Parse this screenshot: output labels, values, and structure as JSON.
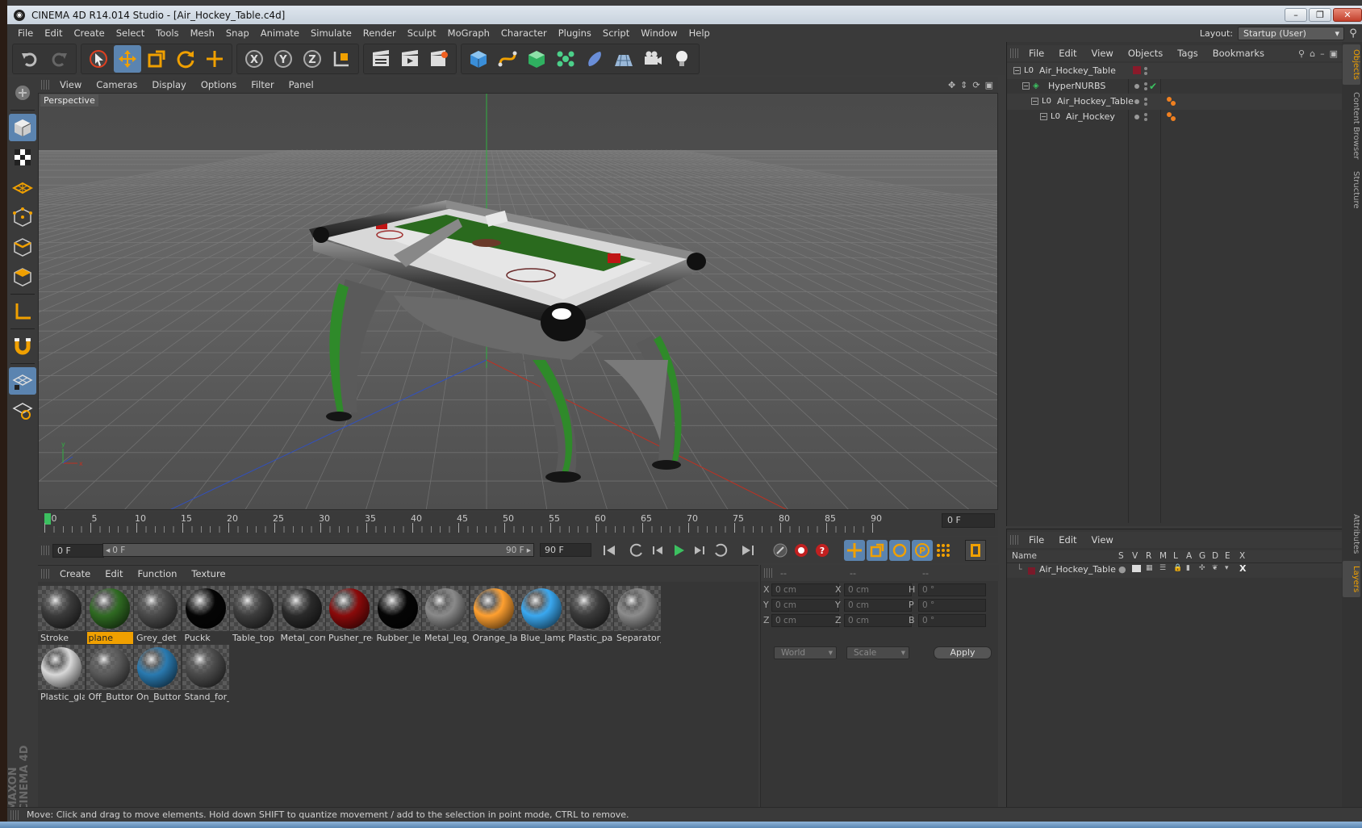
{
  "window": {
    "title": "CINEMA 4D R14.014 Studio - [Air_Hockey_Table.c4d]",
    "controls": [
      "–",
      "❐",
      "✕"
    ]
  },
  "menu": [
    "File",
    "Edit",
    "Create",
    "Select",
    "Tools",
    "Mesh",
    "Snap",
    "Animate",
    "Simulate",
    "Render",
    "Sculpt",
    "MoGraph",
    "Character",
    "Plugins",
    "Script",
    "Window",
    "Help"
  ],
  "layout": {
    "label": "Layout:",
    "value": "Startup (User)"
  },
  "viewport": {
    "menu": [
      "View",
      "Cameras",
      "Display",
      "Options",
      "Filter",
      "Panel"
    ],
    "camera_label": "Perspective"
  },
  "timeline": {
    "ticks": [
      "0",
      "5",
      "10",
      "15",
      "20",
      "25",
      "30",
      "35",
      "40",
      "45",
      "50",
      "55",
      "60",
      "65",
      "70",
      "75",
      "80",
      "85",
      "90"
    ],
    "current_frame_field": "0 F"
  },
  "transport": {
    "start_field": "0 F",
    "range_start": "0 F",
    "range_end": "90 F",
    "end_field": "90 F"
  },
  "materials": {
    "menu": [
      "Create",
      "Edit",
      "Function",
      "Texture"
    ],
    "items": [
      {
        "name": "Stroke",
        "color": "#3a3a3a",
        "selected": false
      },
      {
        "name": "plane",
        "color": "#2f6a22",
        "selected": true
      },
      {
        "name": "Grey_det",
        "color": "#4a4a4a",
        "selected": false
      },
      {
        "name": "Puckk",
        "color": "#050505",
        "selected": false
      },
      {
        "name": "Table_top",
        "color": "#3c3c3c",
        "selected": false
      },
      {
        "name": "Metal_corn",
        "color": "#2a2a2a",
        "selected": false
      },
      {
        "name": "Pusher_red",
        "color": "#8a0a0a",
        "selected": false
      },
      {
        "name": "Rubber_leg",
        "color": "#050505",
        "selected": false
      },
      {
        "name": "Metal_leg_",
        "color": "#8a8a8a",
        "selected": false
      },
      {
        "name": "Orange_lar",
        "color": "#ffa030",
        "selected": false
      },
      {
        "name": "Blue_lamp",
        "color": "#3aa8f0",
        "selected": false
      },
      {
        "name": "Plastic_pan",
        "color": "#3a3a3a",
        "selected": false
      },
      {
        "name": "Separator_",
        "color": "#8c8c8c",
        "selected": false
      },
      {
        "name": "Plastic_glas",
        "color": "#d8d8d8",
        "selected": false
      },
      {
        "name": "Off_Button",
        "color": "#5a5a5a",
        "selected": false
      },
      {
        "name": "On_Button",
        "color": "#2a7ab0",
        "selected": false
      },
      {
        "name": "Stand_for_",
        "color": "#4a4a4a",
        "selected": false
      }
    ]
  },
  "coordinates": {
    "headers": [
      "--",
      "--",
      "--"
    ],
    "rows": [
      {
        "a": "X",
        "av": "0 cm",
        "b": "X",
        "bv": "0 cm",
        "c": "H",
        "cv": "0 °"
      },
      {
        "a": "Y",
        "av": "0 cm",
        "b": "Y",
        "bv": "0 cm",
        "c": "P",
        "cv": "0 °"
      },
      {
        "a": "Z",
        "av": "0 cm",
        "b": "Z",
        "bv": "0 cm",
        "c": "B",
        "cv": "0 °"
      }
    ],
    "mode1": "World",
    "mode2": "Scale",
    "apply": "Apply"
  },
  "objects": {
    "menu": [
      "File",
      "Edit",
      "View",
      "Objects",
      "Tags",
      "Bookmarks"
    ],
    "tree": [
      {
        "name": "Air_Hockey_Table",
        "indent": 0,
        "type": "null"
      },
      {
        "name": "HyperNURBS",
        "indent": 1,
        "type": "nurbs"
      },
      {
        "name": "Air_Hockey_Table",
        "indent": 2,
        "type": "null"
      },
      {
        "name": "Air_Hockey",
        "indent": 3,
        "type": "null"
      }
    ]
  },
  "layers": {
    "menu": [
      "File",
      "Edit",
      "View"
    ],
    "columns": [
      "Name",
      "S",
      "V",
      "R",
      "M",
      "L",
      "A",
      "G",
      "D",
      "E",
      "X"
    ],
    "rows": [
      {
        "name": "Air_Hockey_Table",
        "color": "#7a1a2a"
      }
    ]
  },
  "side_tabs": [
    "Objects",
    "Content Browser",
    "Structure",
    "Attributes",
    "Layers"
  ],
  "status": "Move: Click and drag to move elements. Hold down SHIFT to quantize movement / add to the selection in point mode, CTRL to remove.",
  "brand": "MAXON CINEMA 4D",
  "colors": {
    "accent": "#f0a000",
    "active_tool": "#5b84b0",
    "panel": "#3a3a3a"
  }
}
